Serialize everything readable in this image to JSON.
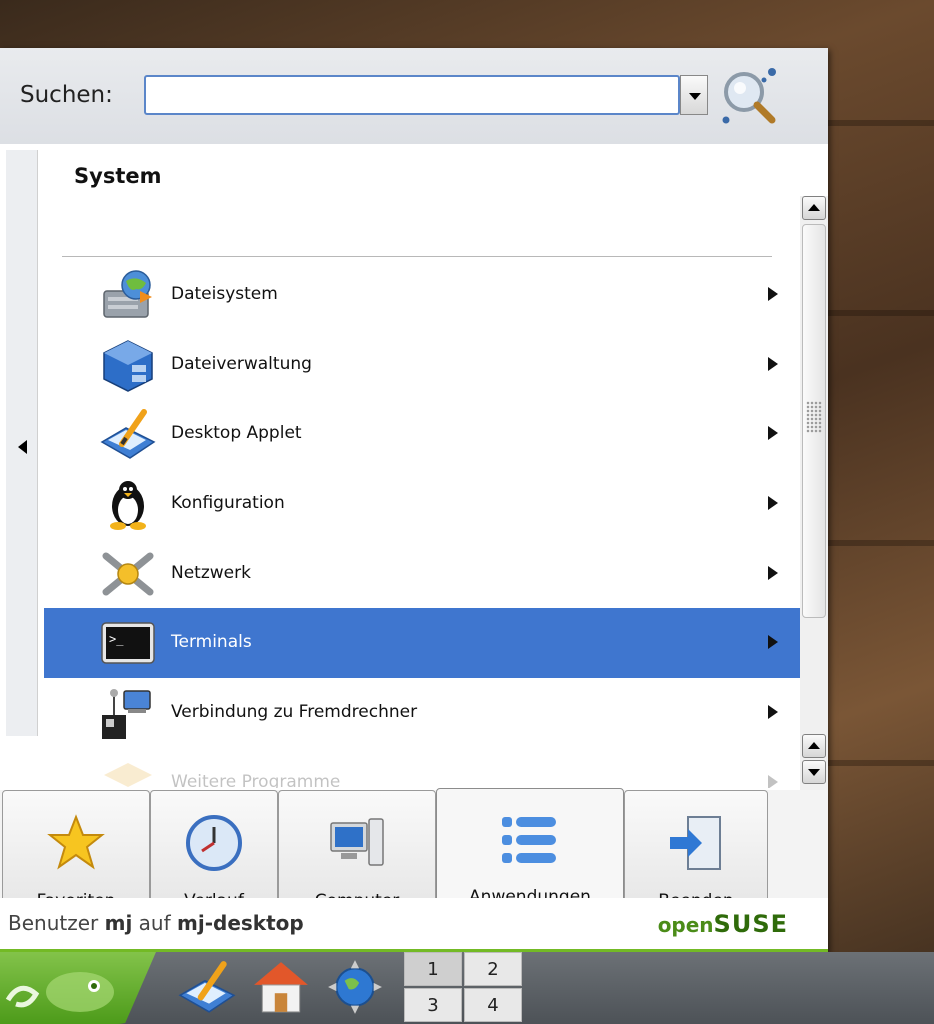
{
  "window": {
    "search": {
      "label": "Suchen:",
      "value": "",
      "placeholder": ""
    },
    "category_title": "System",
    "menu_items": [
      {
        "label": "Dateisystem",
        "icon": "harddisk-icon",
        "has_submenu": true,
        "selected": false
      },
      {
        "label": "Dateiverwaltung",
        "icon": "file-cabinet-icon",
        "has_submenu": true,
        "selected": false
      },
      {
        "label": "Desktop Applet",
        "icon": "desktop-pen-icon",
        "has_submenu": true,
        "selected": false
      },
      {
        "label": "Konfiguration",
        "icon": "tux-penguin-icon",
        "has_submenu": true,
        "selected": false
      },
      {
        "label": "Netzwerk",
        "icon": "network-tools-icon",
        "has_submenu": true,
        "selected": false
      },
      {
        "label": "Terminals",
        "icon": "terminal-icon",
        "has_submenu": true,
        "selected": true
      },
      {
        "label": "Verbindung zu Fremdrechner",
        "icon": "remote-computer-icon",
        "has_submenu": true,
        "selected": false
      },
      {
        "label": "Weitere Programme",
        "icon": "folder-icon",
        "has_submenu": true,
        "selected": false
      }
    ],
    "tabs": [
      {
        "label": "Favoriten",
        "icon": "star-icon",
        "active": false
      },
      {
        "label": "Verlauf",
        "icon": "clock-icon",
        "active": false
      },
      {
        "label": "Computer",
        "icon": "computer-icon",
        "active": false
      },
      {
        "label": "Anwendungen",
        "icon": "applications-list-icon",
        "active": true
      },
      {
        "label": "Beenden",
        "icon": "exit-door-icon",
        "active": false
      }
    ],
    "footer": {
      "user_prefix": "Benutzer",
      "user_name": "mj",
      "user_middle": "auf",
      "host_name": "mj-desktop",
      "logo_light": "open",
      "logo_strong": "SUSE"
    }
  },
  "panel": {
    "pager": [
      "1",
      "2",
      "3",
      "4"
    ],
    "launchers": [
      "desktop-pen-icon",
      "home-folder-icon",
      "konqueror-globe-icon"
    ]
  },
  "colors": {
    "selection": "#3f76cf",
    "accent_green": "#73ba25",
    "search_border": "#5b86c9"
  }
}
